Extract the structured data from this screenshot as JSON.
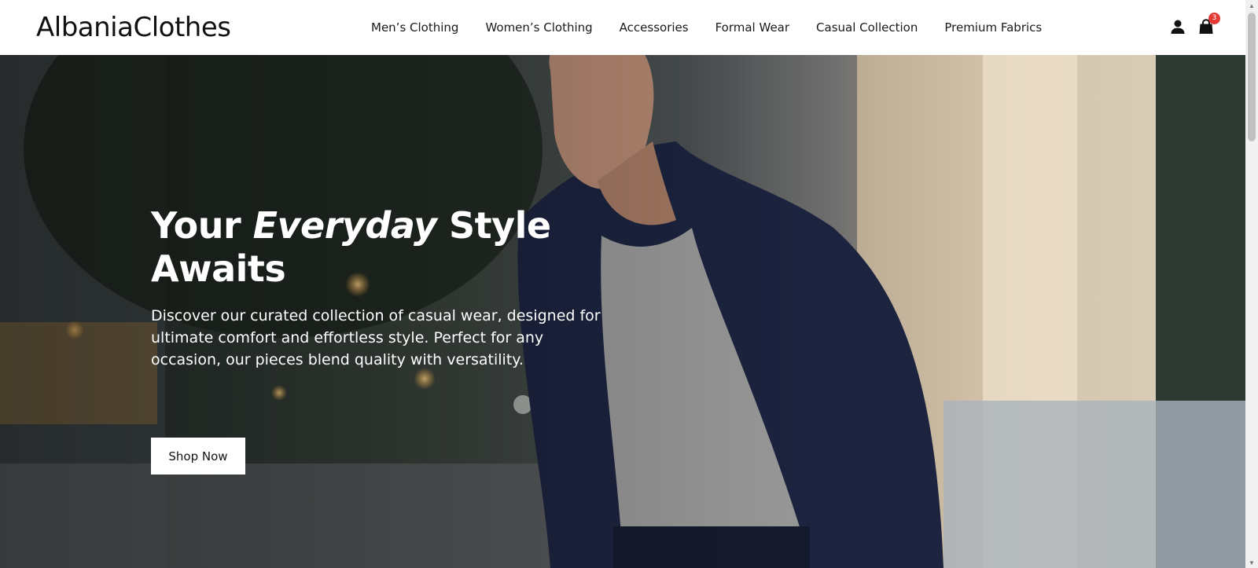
{
  "brand": {
    "name": "AlbaniaClothes"
  },
  "nav": {
    "items": [
      {
        "label": "Men’s Clothing"
      },
      {
        "label": "Women’s Clothing"
      },
      {
        "label": "Accessories"
      },
      {
        "label": "Formal Wear"
      },
      {
        "label": "Casual Collection"
      },
      {
        "label": "Premium Fabrics"
      }
    ]
  },
  "header_icons": {
    "account": "user-icon",
    "cart": "shopping-bag-icon",
    "cart_count": "3",
    "badge_color": "#e53935"
  },
  "hero": {
    "title_start": "Your ",
    "title_emphasis": "Everyday",
    "title_end": " Style Awaits",
    "description": "Discover our curated collection of casual wear, designed for ultimate comfort and effortless style. Perfect for any occasion, our pieces blend quality with versatility.",
    "cta_label": "Shop Now"
  }
}
